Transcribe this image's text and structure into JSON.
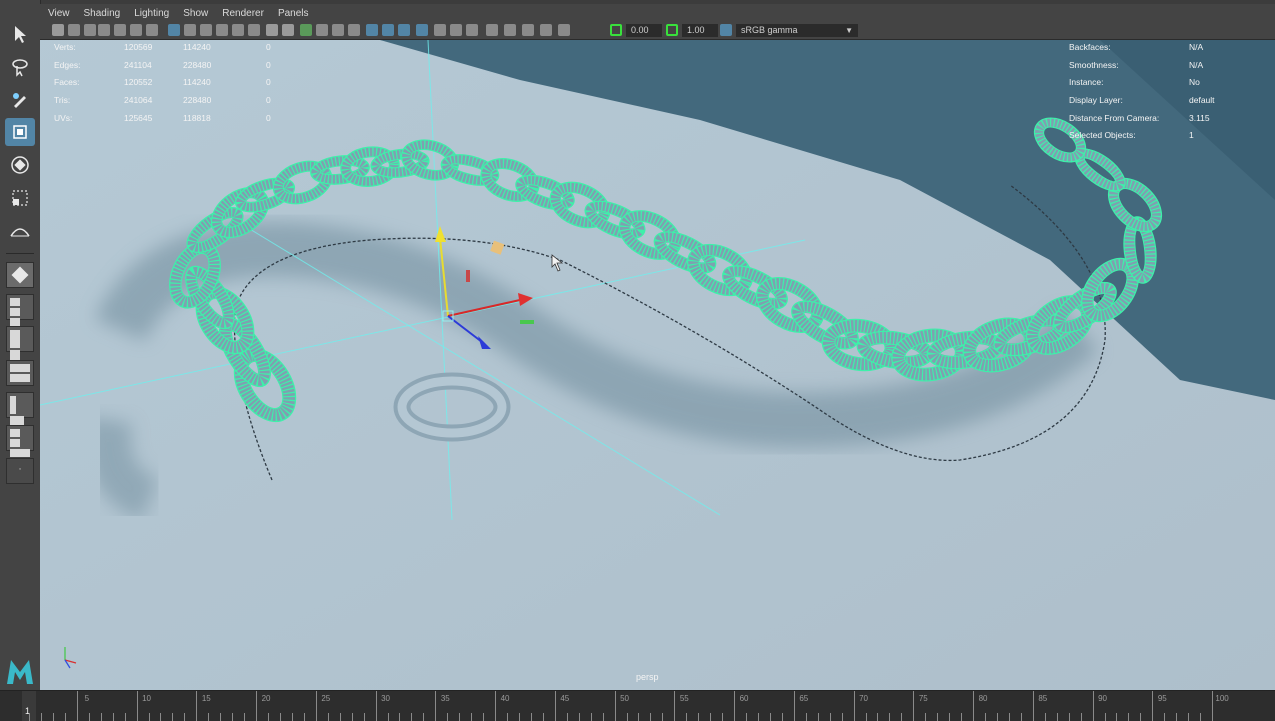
{
  "menu": [
    "View",
    "Shading",
    "Lighting",
    "Show",
    "Renderer",
    "Panels"
  ],
  "panel_toolbar": {
    "exposure": "0.00",
    "gamma": "1.00",
    "colorspace": "sRGB gamma"
  },
  "hud_left": {
    "labels": [
      "Verts:",
      "Edges:",
      "Faces:",
      "Tris:",
      "UVs:"
    ],
    "col1": [
      "120569",
      "241104",
      "120552",
      "241064",
      "125645"
    ],
    "col2": [
      "114240",
      "228480",
      "114240",
      "228480",
      "118818"
    ],
    "col3": [
      "0",
      "0",
      "0",
      "0",
      "0"
    ]
  },
  "hud_right": {
    "labels": [
      "Backfaces:",
      "Smoothness:",
      "Instance:",
      "Display Layer:",
      "Distance From Camera:",
      "Selected Objects:"
    ],
    "values": [
      "N/A",
      "N/A",
      "No",
      "default",
      "3.115",
      "1"
    ]
  },
  "camera_name": "persp",
  "timeline": {
    "current_frame": "1",
    "labels": [
      "5",
      "10",
      "15",
      "20",
      "25",
      "30",
      "35",
      "40",
      "45",
      "50",
      "55",
      "60",
      "65",
      "70",
      "75",
      "80",
      "85",
      "90",
      "95",
      "100"
    ]
  },
  "icons": [
    "select-arrow",
    "lasso",
    "paint-select",
    "move",
    "rotate",
    "scale",
    "soft-mod",
    "maya-logo",
    "axis-gizmo"
  ],
  "colors": {
    "wireframe": "#3ef0aa",
    "floor": "#b6c8d4",
    "shadow": "#3e6275",
    "toolbar": "#444444",
    "active": "#5285a6"
  }
}
